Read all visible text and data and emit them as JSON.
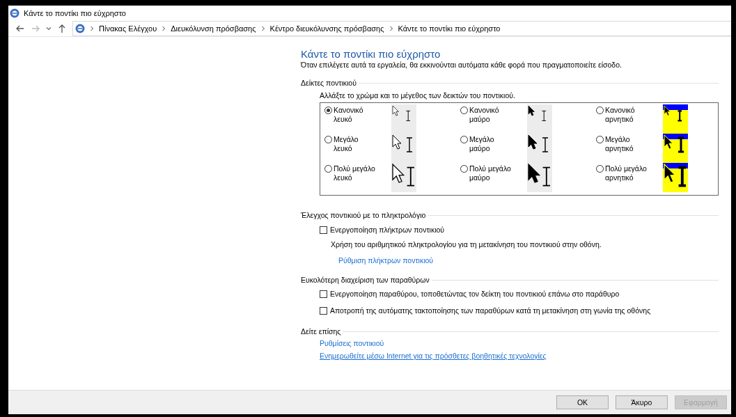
{
  "window": {
    "title": "Κάντε το ποντίκι πιο εύχρηστο"
  },
  "breadcrumb": [
    "Πίνακας Ελέγχου",
    "Διευκόλυνση πρόσβασης",
    "Κέντρο διευκόλυνσης πρόσβασης",
    "Κάντε το ποντίκι πιο εύχρηστο"
  ],
  "page": {
    "title": "Κάντε το ποντίκι πιο εύχρηστο",
    "subtitle": "Όταν επιλέγετε αυτά τα εργαλεία, θα εκκινούνται αυτόματα κάθε φορά που πραγματοποιείτε είσοδο."
  },
  "pointers": {
    "heading": "Δείκτες ποντικιού",
    "description": "Αλλάξτε το χρώμα και το μέγεθος των δεικτών του ποντικιού.",
    "options": [
      {
        "label": "Κανονικό λευκό",
        "kind": "white",
        "selected": true
      },
      {
        "label": "Κανονικό μαύρο",
        "kind": "black",
        "selected": false
      },
      {
        "label": "Κανονικό αρνητικό",
        "kind": "inverted",
        "selected": false
      },
      {
        "label": "Μεγάλο λευκό",
        "kind": "white",
        "selected": false
      },
      {
        "label": "Μεγάλο μαύρο",
        "kind": "black",
        "selected": false
      },
      {
        "label": "Μεγάλο αρνητικό",
        "kind": "inverted",
        "selected": false
      },
      {
        "label": "Πολύ μεγάλο λευκό",
        "kind": "white",
        "selected": false
      },
      {
        "label": "Πολύ μεγάλο μαύρο",
        "kind": "black",
        "selected": false
      },
      {
        "label": "Πολύ μεγάλο αρνητικό",
        "kind": "inverted",
        "selected": false
      }
    ]
  },
  "keyboard": {
    "heading": "Έλεγχος ποντικιού με το πληκτρολόγιο",
    "checkbox": {
      "label": "Ενεργοποίηση πλήκτρων ποντικιού",
      "checked": false
    },
    "note": "Χρήση του αριθμητικού πληκτρολογίου για τη μετακίνηση του ποντικιού στην οθόνη.",
    "link": "Ρύθμιση πλήκτρων ποντικιού"
  },
  "windows": {
    "heading": "Ευκολότερη διαχείριση των παραθύρων",
    "checkboxes": [
      {
        "label": "Ενεργοποίηση παραθύρου, τοποθετώντας τον δείκτη του ποντικιού επάνω στο παράθυρο",
        "checked": false
      },
      {
        "label": "Αποτροπή της αυτόματης τακτοποίησης των παραθύρων κατά τη μετακίνηση στη γωνία της οθόνης",
        "checked": false
      }
    ]
  },
  "see_also": {
    "heading": "Δείτε επίσης",
    "links": [
      "Ρυθμίσεις ποντικιού",
      "Ενημερωθείτε μέσω Internet για τις πρόσθετες βοηθητικές τεχνολογίες"
    ]
  },
  "buttons": [
    {
      "label": "OK",
      "disabled": false
    },
    {
      "label": "Άκυρο",
      "disabled": false
    },
    {
      "label": "Εφαρμογή",
      "disabled": true
    }
  ]
}
